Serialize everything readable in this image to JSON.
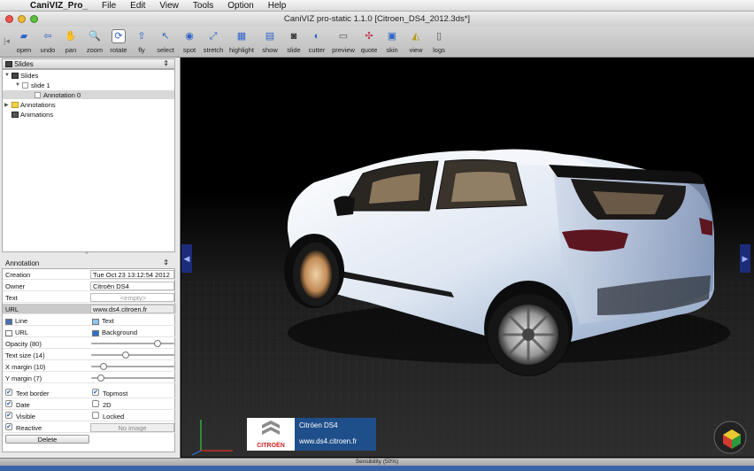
{
  "menubar": {
    "app_name": "CaniVIZ_Pro_",
    "items": [
      "File",
      "Edit",
      "View",
      "Tools",
      "Option",
      "Help"
    ]
  },
  "window": {
    "title": "CaniVIZ pro-static 1.1.0 [Citroen_DS4_2012.3ds*]"
  },
  "toolbar": {
    "buttons": [
      {
        "label": "open",
        "icon": "folder-icon"
      },
      {
        "label": "undo",
        "icon": "undo-icon"
      },
      {
        "label": "pan",
        "icon": "pan-icon"
      },
      {
        "label": "zoom",
        "icon": "zoom-icon"
      },
      {
        "label": "rotate",
        "icon": "rotate-icon"
      },
      {
        "label": "fly",
        "icon": "fly-icon"
      },
      {
        "label": "select",
        "icon": "select-icon"
      },
      {
        "label": "spot",
        "icon": "spot-icon"
      },
      {
        "label": "stretch",
        "icon": "stretch-icon"
      },
      {
        "label": "highlight",
        "icon": "highlight-icon"
      },
      {
        "label": "show",
        "icon": "show-icon"
      },
      {
        "label": "slide",
        "icon": "camera-icon"
      },
      {
        "label": "cutter",
        "icon": "cutter-icon"
      },
      {
        "label": "preview",
        "icon": "printer-icon"
      },
      {
        "label": "quote",
        "icon": "quote-icon"
      },
      {
        "label": "skin",
        "icon": "skin-icon"
      },
      {
        "label": "view",
        "icon": "view-icon"
      },
      {
        "label": "logs",
        "icon": "logs-icon"
      }
    ],
    "selected": "rotate"
  },
  "slides_panel": {
    "header": "Slides",
    "tree": {
      "root": "Slides",
      "slide": "slide 1",
      "annotation": "Annotation 0",
      "annotations": "Annotations",
      "animations": "Animations"
    }
  },
  "annotation_panel": {
    "header": "Annotation",
    "creation_label": "Creation",
    "creation_value": "Tue Oct 23 13:12:54 2012",
    "owner_label": "Owner",
    "owner_value": "Citroën DS4",
    "text_label": "Text",
    "text_value": "<empty>",
    "url_label": "URL",
    "url_value": "www.ds4.citroen.fr",
    "line_label": "Line",
    "text_color_label": "Text",
    "url_color_label": "URL",
    "background_label": "Background",
    "opacity_label": "Opacity (80)",
    "opacity": 0.8,
    "text_size_label": "Text size (14)",
    "text_size": 0.42,
    "x_margin_label": "X margin (10)",
    "x_margin": 0.15,
    "y_margin_label": "Y margin (7)",
    "y_margin": 0.12,
    "text_border_label": "Text border",
    "text_border": true,
    "topmost_label": "Topmost",
    "topmost": true,
    "date_label": "Date",
    "date": true,
    "twod_label": "2D",
    "twod": false,
    "visible_label": "Visible",
    "visible": true,
    "locked_label": "Locked",
    "locked": false,
    "reactive_label": "Reactive",
    "reactive": true,
    "no_image_label": "No image",
    "delete_label": "Delete",
    "colors": {
      "line": "#4a6fb5",
      "text": "#8ec5ec",
      "url": "#ffffff",
      "background": "#2f6fcc"
    }
  },
  "viewport": {
    "annotation_title": "Citröen DS4",
    "annotation_url": "www.ds4.citroen.fr",
    "logo_text": "CITROËN"
  },
  "status": {
    "sensibility": "Sensibility (50%)"
  }
}
